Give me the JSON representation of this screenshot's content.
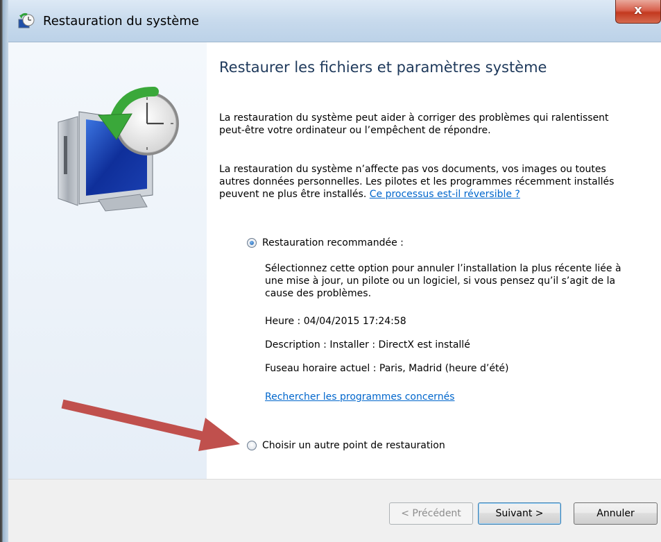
{
  "window": {
    "title": "Restauration du système",
    "close_symbol": "x"
  },
  "icons": {
    "title_icon": "system-restore-icon",
    "panel_image": "system-restore-computer-clock-icon"
  },
  "content": {
    "heading": "Restaurer les fichiers et paramètres système",
    "paragraph1": "La restauration du système peut aider à corriger des problèmes qui ralentissent peut-être votre ordinateur ou l’empêchent de répondre.",
    "paragraph2": "La restauration du système n’affecte pas vos documents, vos images ou toutes autres données personnelles. Les pilotes et les programmes récemment installés peuvent ne plus être installés.",
    "paragraph2_link": "Ce processus est-il réversible ?",
    "option_recommended": {
      "label": "Restauration recommandée :",
      "checked": true,
      "description": "Sélectionnez cette option pour annuler l’installation la plus récente liée à une mise à jour, un pilote ou un logiciel, si vous pensez qu’il s’agit de la cause des problèmes.",
      "time": "Heure : 04/04/2015 17:24:58",
      "info": "Description : Installer : DirectX est installé",
      "timezone": "Fuseau horaire actuel : Paris, Madrid (heure d’été)",
      "link": "Rechercher les programmes concernés"
    },
    "option_other": {
      "label": "Choisir un autre point de restauration",
      "checked": false
    }
  },
  "buttons": {
    "previous": "< Précédent",
    "next": "Suivant >",
    "cancel": "Annuler"
  },
  "annotation": {
    "arrow_color": "#c0504d"
  }
}
